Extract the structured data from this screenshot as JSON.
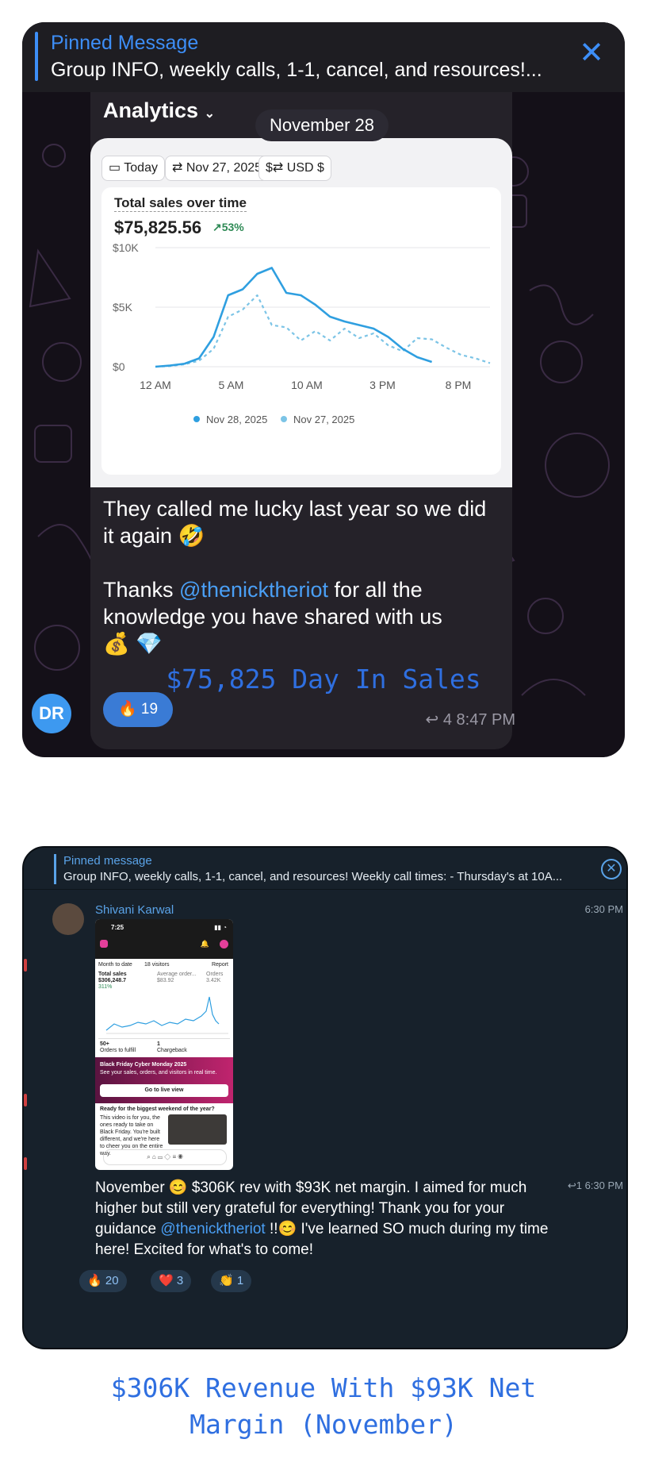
{
  "card1": {
    "pinned": {
      "title": "Pinned Message",
      "text": "Group INFO, weekly calls, 1-1, cancel, and resources!..."
    },
    "analytics_label": "Analytics",
    "date_pill": "November 28",
    "chips": {
      "today": "Today",
      "compare": "Nov 27, 2025",
      "currency": "USD $"
    },
    "chart_title": "Total sales over time",
    "total_value": "$75,825.56",
    "change": "53%",
    "message_line1": "They called me lucky last year so we did it again 🤣",
    "message_thanks": "Thanks ",
    "mention": "@thenicktheriot",
    "message_rest": " for all the knowledge you have shared with us",
    "emojis": "💰 💎",
    "avatar_initials": "DR",
    "reaction": {
      "emoji": "🔥",
      "count": "19"
    },
    "replies": "4",
    "time": "8:47 PM"
  },
  "caption1": "$75,825 Day In Sales",
  "card2": {
    "pinned": {
      "title": "Pinned message",
      "text": "Group INFO, weekly calls, 1-1, cancel, and resources!   Weekly call times:  - Thursday's at 10A..."
    },
    "sender": "Shivani Karwal",
    "time": "6:30 PM",
    "phone": {
      "clock": "7:25",
      "filter_period": "Month to date",
      "filter_visitors": "18 visitors",
      "report": "Report",
      "total_label": "Total sales",
      "total_value": "$306,248.7",
      "total_change": "311%",
      "aov_label": "Average order...",
      "aov_value": "$83.92",
      "orders_label": "Orders",
      "orders_value": "3.42K",
      "fulfill_value": "50+",
      "fulfill_label": "Orders to fulfill",
      "chargeback_value": "1",
      "chargeback_label": "Chargeback",
      "promo_title": "Black Friday Cyber Monday 2025",
      "promo_sub": "See your sales, orders, and visitors in real time.",
      "promo_button": "Go to live view",
      "video_title": "Ready for the biggest weekend of the year?",
      "video_text": "This video is for you, the ones ready to take on Black Friday. You're built different, and we're here to cheer you on the entire way."
    },
    "message_a": "November 😊 $306K rev with $93K net margin. I aimed for much higher but still very grateful for everything! Thank you for your guidance ",
    "mention": "@thenicktheriot",
    "message_b": " !!😊 I've learned SO much during my time here! Excited for what's to come!",
    "replies": "1",
    "reactions": [
      {
        "emoji": "🔥",
        "count": "20"
      },
      {
        "emoji": "❤️",
        "count": "3"
      },
      {
        "emoji": "👏",
        "count": "1"
      }
    ]
  },
  "caption2_line1": "$306K Revenue With $93K Net",
  "caption2_line2": "Margin (November)",
  "chart_data": {
    "type": "line",
    "title": "Total sales over time",
    "categories": [
      "12 AM",
      "5 AM",
      "10 AM",
      "3 PM",
      "8 PM"
    ],
    "x": [
      0,
      1,
      2,
      3,
      4,
      5,
      6,
      7,
      8,
      9,
      10,
      11,
      12,
      13,
      14,
      15,
      16,
      17,
      18,
      19,
      20,
      21,
      22,
      23
    ],
    "y_ticks": [
      "$0",
      "$5K",
      "$10K"
    ],
    "ylim": [
      0,
      10000
    ],
    "legend_position": "bottom",
    "colors": {
      "nov28": "#2f9fe0",
      "nov27": "#7cc4e6"
    },
    "series": [
      {
        "name": "Nov 28, 2025",
        "values": [
          0,
          100,
          250,
          700,
          2500,
          6000,
          6500,
          7800,
          8300,
          6200,
          6000,
          5200,
          4200,
          3800,
          3500,
          3200,
          2500,
          1500,
          800,
          400,
          null,
          null,
          null,
          null
        ]
      },
      {
        "name": "Nov 27, 2025",
        "values": [
          0,
          50,
          200,
          500,
          1500,
          4200,
          4800,
          6000,
          3500,
          3300,
          2200,
          3000,
          2200,
          3200,
          2400,
          2800,
          1800,
          1300,
          2400,
          2300,
          1600,
          1000,
          700,
          300
        ]
      }
    ]
  }
}
